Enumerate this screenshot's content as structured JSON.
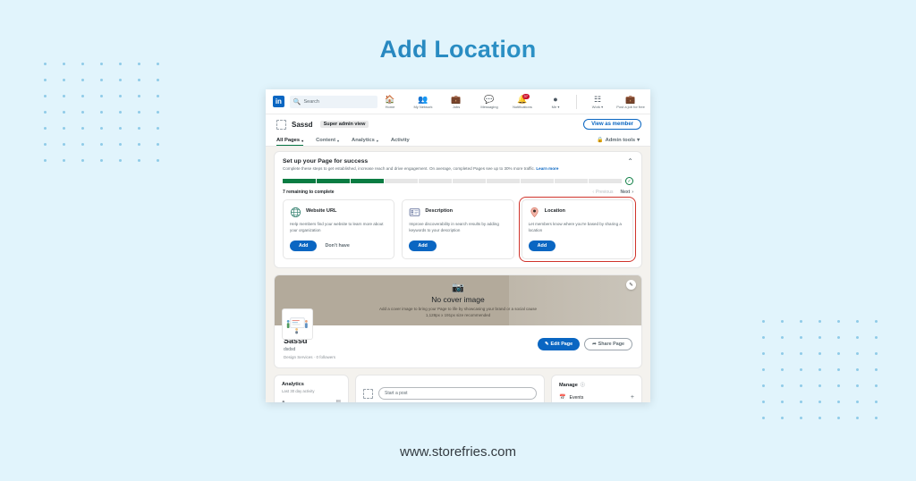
{
  "banner": {
    "title": "Add Location",
    "footer_url": "www.storefries.com",
    "title_color": "#2a84bd",
    "background_color": "#e1f4fc",
    "dot_color": "#8fcbe8",
    "dot_grid_cols": 7,
    "dot_grid_rows": 7
  },
  "linkedin": {
    "logo_text": "in",
    "search": {
      "placeholder": "Search",
      "icon": "search-icon"
    },
    "nav_items": [
      {
        "icon": "home-icon",
        "label": "Home",
        "badge": ""
      },
      {
        "icon": "my-network-icon",
        "label": "My Network",
        "badge": ""
      },
      {
        "icon": "jobs-icon",
        "label": "Jobs",
        "badge": ""
      },
      {
        "icon": "messaging-icon",
        "label": "Messaging",
        "badge": ""
      },
      {
        "icon": "notifications-icon",
        "label": "Notifications",
        "badge": "37"
      },
      {
        "icon": "me-avatar-icon",
        "label": "Me ▾",
        "badge": ""
      },
      {
        "icon": "work-grid-icon",
        "label": "Work ▾",
        "badge": ""
      },
      {
        "icon": "post-job-icon",
        "label": "Post a job for free",
        "badge": ""
      }
    ],
    "admin_strip": {
      "page_name": "Sassd",
      "role_pill": "Super admin view",
      "view_as_member": "View as member"
    },
    "tabs": [
      {
        "label": "All Pages",
        "caret": "▾",
        "active": true
      },
      {
        "label": "Content",
        "caret": "▾",
        "active": false
      },
      {
        "label": "Analytics",
        "caret": "▾",
        "active": false
      },
      {
        "label": "Activity",
        "caret": "",
        "active": false
      }
    ],
    "admin_tools": {
      "label": "Admin tools",
      "caret": "▾",
      "icon": "lock-icon"
    }
  },
  "setup_card": {
    "title": "Set up your Page for success",
    "subtitle": "Complete these steps to get established, increase reach and drive engagement. On average, completed Pages see up to 30% more traffic.",
    "learn_more": "Learn more",
    "collapse_icon": "chevron-up-icon",
    "progress": {
      "total_segments": 10,
      "filled_segments": 3,
      "check_icon": "✓",
      "fill_color": "#0a7c42"
    },
    "remaining_text": "7 remaining to complete",
    "pager": {
      "previous": "Previous",
      "next": "Next"
    },
    "cards": [
      {
        "icon": "globe-icon",
        "title": "Website URL",
        "description": "Help members find your website to learn more about your organization",
        "primary_button": "Add",
        "secondary_button": "Don't have",
        "highlighted": false
      },
      {
        "icon": "description-card-icon",
        "title": "Description",
        "description": "Improve discoverability in search results by adding keywords to your description",
        "primary_button": "Add",
        "secondary_button": "",
        "highlighted": false
      },
      {
        "icon": "location-pin-icon",
        "title": "Location",
        "description": "Let members know where you're based by sharing a location",
        "primary_button": "Add",
        "secondary_button": "",
        "highlighted": true,
        "highlight_color": "#d0342c"
      }
    ]
  },
  "profile": {
    "cover": {
      "icon": "camera-icon",
      "title": "No cover image",
      "description": "Add a cover image to bring your Page to life by showcasing your brand or a social cause",
      "dimensions": "1,128px x 191px size recommended",
      "edit_icon": "pencil-icon",
      "background_color": "#b3aa9b"
    },
    "logo_icon": "page-logo-illustration",
    "name": "Sassd",
    "tagline": "dsdsd",
    "meta": "Design Services · 0 followers",
    "edit_page_button": "Edit Page",
    "share_page_button": "Share Page"
  },
  "widgets": {
    "analytics": {
      "title": "Analytics",
      "subtitle": "Last 30 day activity"
    },
    "post": {
      "placeholder": "Start a post",
      "avatar_icon": "page-avatar-icon"
    },
    "manage": {
      "title": "Manage",
      "info_icon": "info-icon",
      "rows": [
        {
          "icon": "calendar-icon",
          "label": "Events",
          "action": "+"
        }
      ]
    }
  }
}
